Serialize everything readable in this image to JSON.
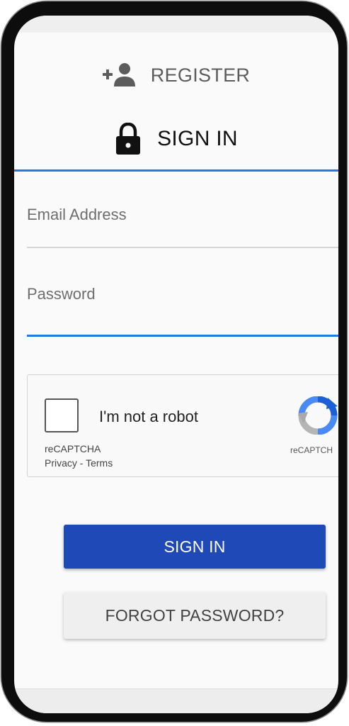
{
  "tabs": {
    "register": {
      "label": "REGISTER",
      "icon": "add-person-icon"
    },
    "sign_in": {
      "label": "SIGN IN",
      "icon": "lock-icon",
      "active": true
    }
  },
  "form": {
    "email": {
      "label": "Email Address",
      "value": ""
    },
    "password": {
      "label": "Password",
      "value": ""
    }
  },
  "captcha": {
    "checkbox_label": "I'm not a robot",
    "brand": "reCAPTCHA",
    "privacy": "Privacy",
    "separator": " - ",
    "terms": "Terms",
    "logo_text": "reCAPTCH",
    "icon": "recaptcha-logo-icon"
  },
  "buttons": {
    "sign_in": "SIGN IN",
    "forgot_password": "FORGOT PASSWORD?"
  },
  "colors": {
    "accent": "#1e7be0",
    "primary_button": "#1f49b6",
    "secondary_button": "#efefef"
  }
}
